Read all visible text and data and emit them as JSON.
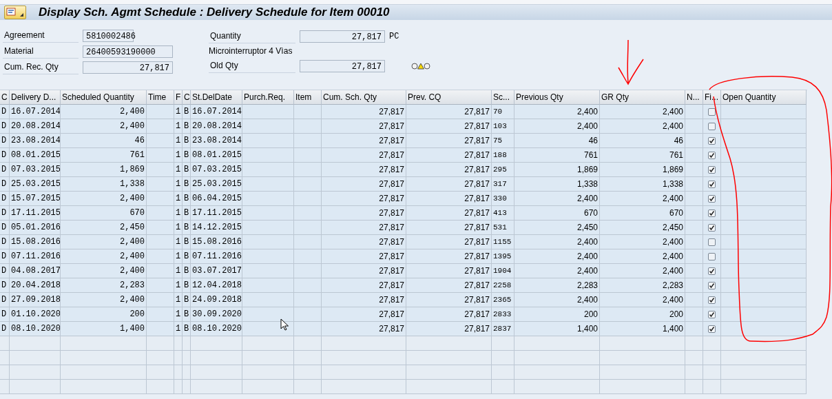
{
  "title": "Display Sch. Agmt Schedule : Delivery Schedule for Item 00010",
  "header": {
    "agreement_label": "Agreement",
    "agreement": "5810002486",
    "material_label": "Material",
    "material": "26400593190000",
    "cum_rec_qty_label": "Cum. Rec. Qty",
    "cum_rec_qty": "27,817",
    "quantity_label": "Quantity",
    "quantity": "27,817",
    "unit": "PC",
    "material_description": "Microinterruptor 4 Vìas",
    "old_qty_label": "Old Qty",
    "old_qty": "27,817"
  },
  "table": {
    "columns": [
      "C",
      "Delivery D...",
      "Scheduled Quantity",
      "Time",
      "F",
      "C",
      "St.DelDate",
      "Purch.Req.",
      "Item",
      "Cum. Sch. Qty",
      "Prev. CQ",
      "Sc...",
      "Previous Qty",
      "GR Qty",
      "N...",
      "Fi...",
      "Open Quantity"
    ],
    "rows": [
      {
        "c": "D",
        "delivery_date": "16.07.2014",
        "scheduled_qty": "2,400",
        "f": "1",
        "c2": "B",
        "st_del_date": "16.07.2014",
        "cum_sch_qty": "27,817",
        "prev_cq": "27,817",
        "sc": "70",
        "previous_qty": "2,400",
        "gr_qty": "2,400",
        "checked": false
      },
      {
        "c": "D",
        "delivery_date": "20.08.2014",
        "scheduled_qty": "2,400",
        "f": "1",
        "c2": "B",
        "st_del_date": "20.08.2014",
        "cum_sch_qty": "27,817",
        "prev_cq": "27,817",
        "sc": "103",
        "previous_qty": "2,400",
        "gr_qty": "2,400",
        "checked": false
      },
      {
        "c": "D",
        "delivery_date": "23.08.2014",
        "scheduled_qty": "46",
        "f": "1",
        "c2": "B",
        "st_del_date": "23.08.2014",
        "cum_sch_qty": "27,817",
        "prev_cq": "27,817",
        "sc": "75",
        "previous_qty": "46",
        "gr_qty": "46",
        "checked": true
      },
      {
        "c": "D",
        "delivery_date": "08.01.2015",
        "scheduled_qty": "761",
        "f": "1",
        "c2": "B",
        "st_del_date": "08.01.2015",
        "cum_sch_qty": "27,817",
        "prev_cq": "27,817",
        "sc": "188",
        "previous_qty": "761",
        "gr_qty": "761",
        "checked": true
      },
      {
        "c": "D",
        "delivery_date": "07.03.2015",
        "scheduled_qty": "1,869",
        "f": "1",
        "c2": "B",
        "st_del_date": "07.03.2015",
        "cum_sch_qty": "27,817",
        "prev_cq": "27,817",
        "sc": "295",
        "previous_qty": "1,869",
        "gr_qty": "1,869",
        "checked": true
      },
      {
        "c": "D",
        "delivery_date": "25.03.2015",
        "scheduled_qty": "1,338",
        "f": "1",
        "c2": "B",
        "st_del_date": "25.03.2015",
        "cum_sch_qty": "27,817",
        "prev_cq": "27,817",
        "sc": "317",
        "previous_qty": "1,338",
        "gr_qty": "1,338",
        "checked": true
      },
      {
        "c": "D",
        "delivery_date": "15.07.2015",
        "scheduled_qty": "2,400",
        "f": "1",
        "c2": "B",
        "st_del_date": "06.04.2015",
        "cum_sch_qty": "27,817",
        "prev_cq": "27,817",
        "sc": "330",
        "previous_qty": "2,400",
        "gr_qty": "2,400",
        "checked": true
      },
      {
        "c": "D",
        "delivery_date": "17.11.2015",
        "scheduled_qty": "670",
        "f": "1",
        "c2": "B",
        "st_del_date": "17.11.2015",
        "cum_sch_qty": "27,817",
        "prev_cq": "27,817",
        "sc": "413",
        "previous_qty": "670",
        "gr_qty": "670",
        "checked": true
      },
      {
        "c": "D",
        "delivery_date": "05.01.2016",
        "scheduled_qty": "2,450",
        "f": "1",
        "c2": "B",
        "st_del_date": "14.12.2015",
        "cum_sch_qty": "27,817",
        "prev_cq": "27,817",
        "sc": "531",
        "previous_qty": "2,450",
        "gr_qty": "2,450",
        "checked": true
      },
      {
        "c": "D",
        "delivery_date": "15.08.2016",
        "scheduled_qty": "2,400",
        "f": "1",
        "c2": "B",
        "st_del_date": "15.08.2016",
        "cum_sch_qty": "27,817",
        "prev_cq": "27,817",
        "sc": "1155",
        "previous_qty": "2,400",
        "gr_qty": "2,400",
        "checked": false
      },
      {
        "c": "D",
        "delivery_date": "07.11.2016",
        "scheduled_qty": "2,400",
        "f": "1",
        "c2": "B",
        "st_del_date": "07.11.2016",
        "cum_sch_qty": "27,817",
        "prev_cq": "27,817",
        "sc": "1395",
        "previous_qty": "2,400",
        "gr_qty": "2,400",
        "checked": false
      },
      {
        "c": "D",
        "delivery_date": "04.08.2017",
        "scheduled_qty": "2,400",
        "f": "1",
        "c2": "B",
        "st_del_date": "03.07.2017",
        "cum_sch_qty": "27,817",
        "prev_cq": "27,817",
        "sc": "1904",
        "previous_qty": "2,400",
        "gr_qty": "2,400",
        "checked": true
      },
      {
        "c": "D",
        "delivery_date": "20.04.2018",
        "scheduled_qty": "2,283",
        "f": "1",
        "c2": "B",
        "st_del_date": "12.04.2018",
        "cum_sch_qty": "27,817",
        "prev_cq": "27,817",
        "sc": "2258",
        "previous_qty": "2,283",
        "gr_qty": "2,283",
        "checked": true
      },
      {
        "c": "D",
        "delivery_date": "27.09.2018",
        "scheduled_qty": "2,400",
        "f": "1",
        "c2": "B",
        "st_del_date": "24.09.2018",
        "cum_sch_qty": "27,817",
        "prev_cq": "27,817",
        "sc": "2365",
        "previous_qty": "2,400",
        "gr_qty": "2,400",
        "checked": true
      },
      {
        "c": "D",
        "delivery_date": "01.10.2020",
        "scheduled_qty": "200",
        "f": "1",
        "c2": "B",
        "st_del_date": "30.09.2020",
        "cum_sch_qty": "27,817",
        "prev_cq": "27,817",
        "sc": "2833",
        "previous_qty": "200",
        "gr_qty": "200",
        "checked": true
      },
      {
        "c": "D",
        "delivery_date": "08.10.2020",
        "scheduled_qty": "1,400",
        "f": "1",
        "c2": "B",
        "st_del_date": "08.10.2020",
        "cum_sch_qty": "27,817",
        "prev_cq": "27,817",
        "sc": "2837",
        "previous_qty": "1,400",
        "gr_qty": "1,400",
        "checked": true
      }
    ]
  }
}
